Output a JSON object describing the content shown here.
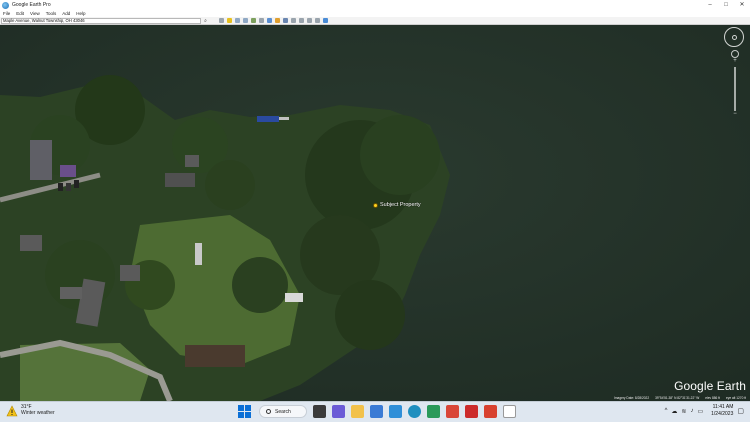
{
  "window": {
    "title": "Google Earth Pro",
    "controls": {
      "minimize": "–",
      "maximize": "□",
      "close": "✕"
    }
  },
  "menu": [
    "File",
    "Edit",
    "View",
    "Tools",
    "Add",
    "Help"
  ],
  "search": {
    "value": "Maple Avenue, Walnut Township, OH 43046"
  },
  "toolbar_icons": [
    "sidebar-icon",
    "placemark-icon",
    "polygon-icon",
    "path-icon",
    "overlay-icon",
    "tour-icon",
    "historical-imagery-icon",
    "sun-icon",
    "planets-icon",
    "ruler-icon",
    "email-icon",
    "print-icon",
    "save-image-icon",
    "maps-icon"
  ],
  "map": {
    "placemark": {
      "label": "Subject Property",
      "color": "#ffd21f"
    },
    "brand": "Google Earth",
    "status": {
      "imagery_date": "Imagery Date: 8/28/2022",
      "coords": "39°54'51.38\" N   82°31'31.22\" W",
      "elevation": "elev  886 ft",
      "eye_alt": "eye alt  1270 ft"
    },
    "colors": {
      "water": "#25342b",
      "tree": "#2f4a24",
      "grass": "#4f6e34"
    }
  },
  "taskbar": {
    "weather": {
      "temp": "31°F",
      "condition": "Winter weather"
    },
    "search_label": "Search",
    "apps": [
      "task-view-icon",
      "chat-icon",
      "file-explorer-icon",
      "notepad-icon",
      "store-icon",
      "edge-icon",
      "folder-app-icon",
      "chrome-icon",
      "antivirus-icon",
      "office-icon",
      "document-icon"
    ],
    "clock": {
      "time": "11:41 AM",
      "date": "1/24/2023"
    }
  }
}
